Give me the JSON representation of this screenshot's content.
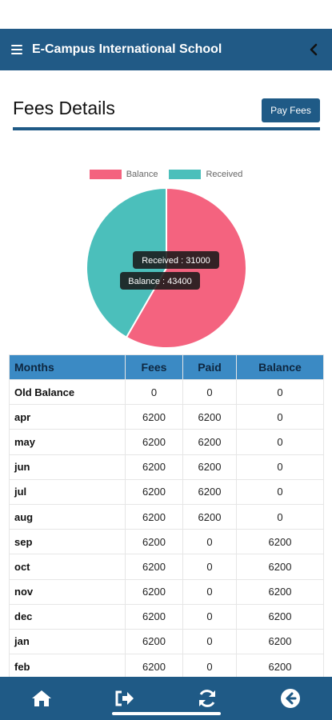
{
  "header": {
    "title": "E-Campus International School"
  },
  "page": {
    "title": "Fees Details",
    "pay_button_label": "Pay Fees"
  },
  "chart_data": {
    "type": "pie",
    "legend": [
      {
        "name": "Balance",
        "color": "#f4637f"
      },
      {
        "name": "Received",
        "color": "#4bbfbb"
      }
    ],
    "slices": [
      {
        "name": "Balance",
        "value": 43400,
        "color": "#f4637f"
      },
      {
        "name": "Received",
        "value": 31000,
        "color": "#4bbfbb"
      }
    ],
    "tooltips": [
      "Received : 31000",
      "Balance : 43400"
    ]
  },
  "table": {
    "headers": [
      "Months",
      "Fees",
      "Paid",
      "Balance"
    ],
    "rows": [
      [
        "Old Balance",
        "0",
        "0",
        "0"
      ],
      [
        "apr",
        "6200",
        "6200",
        "0"
      ],
      [
        "may",
        "6200",
        "6200",
        "0"
      ],
      [
        "jun",
        "6200",
        "6200",
        "0"
      ],
      [
        "jul",
        "6200",
        "6200",
        "0"
      ],
      [
        "aug",
        "6200",
        "6200",
        "0"
      ],
      [
        "sep",
        "6200",
        "0",
        "6200"
      ],
      [
        "oct",
        "6200",
        "0",
        "6200"
      ],
      [
        "nov",
        "6200",
        "0",
        "6200"
      ],
      [
        "dec",
        "6200",
        "0",
        "6200"
      ],
      [
        "jan",
        "6200",
        "0",
        "6200"
      ],
      [
        "feb",
        "6200",
        "0",
        "6200"
      ]
    ]
  },
  "bottom_nav": {
    "items": [
      {
        "icon": "home-icon"
      },
      {
        "icon": "logout-icon"
      },
      {
        "icon": "refresh-icon"
      },
      {
        "icon": "back-circle-icon"
      }
    ]
  },
  "colors": {
    "primary": "#1f5a86",
    "table_header": "#3b8ac4"
  }
}
